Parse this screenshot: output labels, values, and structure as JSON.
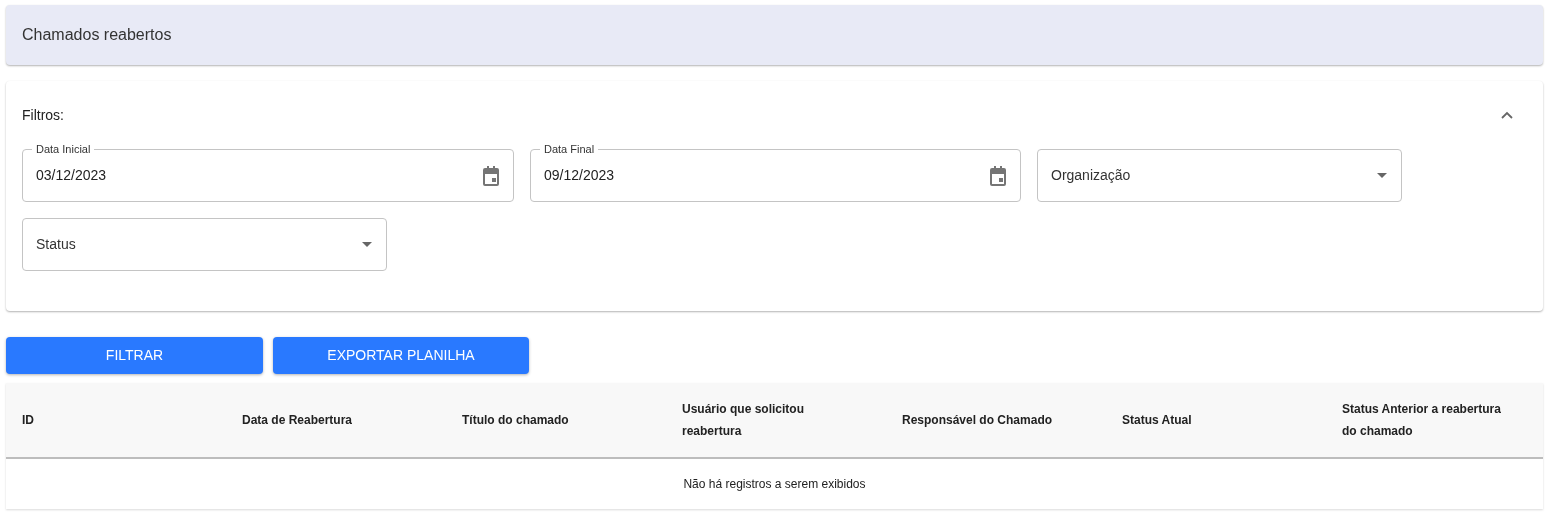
{
  "header": {
    "title": "Chamados reabertos"
  },
  "filters": {
    "title": "Filtros:",
    "expanded": true,
    "fields": [
      {
        "kind": "date",
        "label": "Data Inicial",
        "value": "03/12/2023"
      },
      {
        "kind": "date",
        "label": "Data Final",
        "value": "09/12/2023"
      },
      {
        "kind": "select",
        "label": "Organização"
      },
      {
        "kind": "select",
        "label": "Status"
      }
    ]
  },
  "buttons": [
    "FILTRAR",
    "EXPORTAR PLANILHA"
  ],
  "table": {
    "columns": [
      "ID",
      "Data de Reabertura",
      "Título do chamado",
      "Usuário que solicitou reabertura",
      "Responsável do Chamado",
      "Status Atual",
      "Status Anterior a reabertura do chamado"
    ],
    "empty_message": "Não há registros a serem exibidos"
  }
}
